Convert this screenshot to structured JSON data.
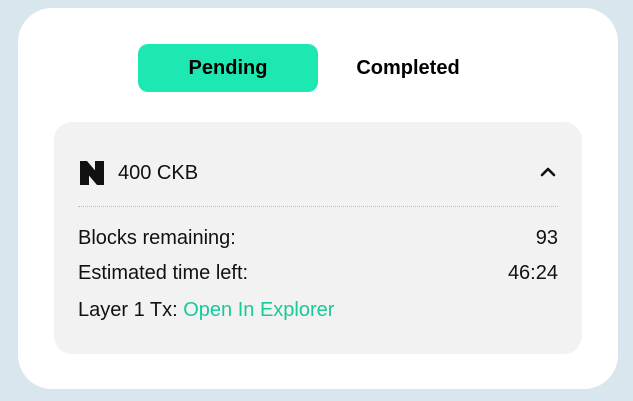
{
  "tabs": {
    "pending": "Pending",
    "completed": "Completed"
  },
  "withdrawal": {
    "amount": "400 CKB",
    "blocks_label": "Blocks remaining:",
    "blocks_value": "93",
    "time_label": "Estimated time left:",
    "time_value": "46:24",
    "tx_label": "Layer 1 Tx:",
    "tx_link": "Open In Explorer"
  },
  "colors": {
    "accent": "#1ee8b2",
    "link": "#17c99b",
    "panel": "#f2f2f2",
    "background": "#d9e6ee"
  },
  "icons": {
    "token": "nervos-logo-icon",
    "collapse": "chevron-up-icon"
  }
}
